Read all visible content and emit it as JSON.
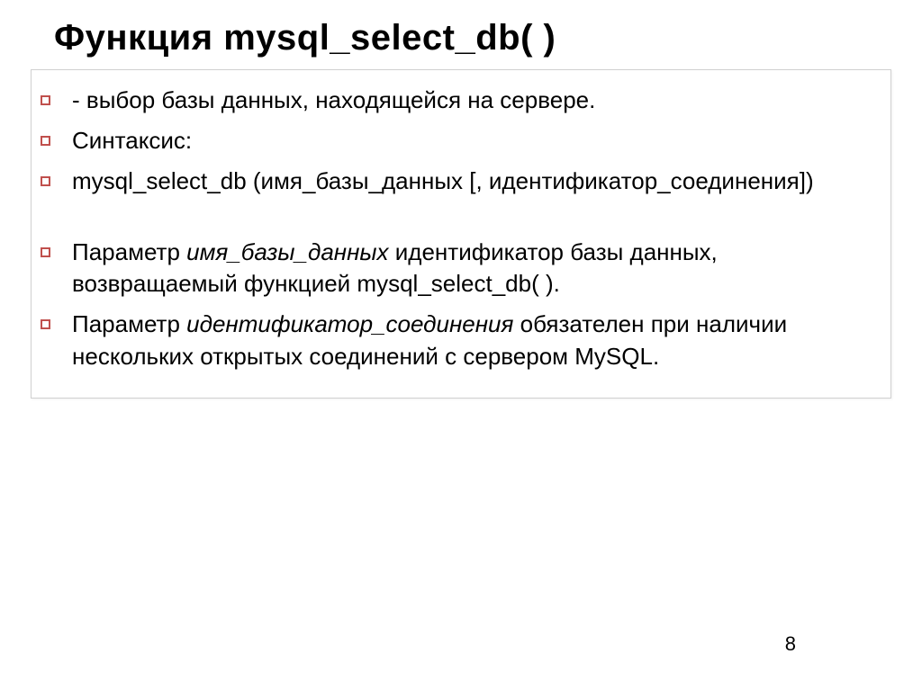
{
  "title": "Функция mysql_select_db( )",
  "bullets": {
    "b1": "- выбор базы данных, находящейся на сервере.",
    "b2": "Синтаксис:",
    "b3": "mysql_select_db (имя_базы_данных [, идентификатор_соединения])",
    "b4_pre": "Параметр ",
    "b4_em": "имя_базы_данных",
    "b4_post": " идентификатор  базы данных, возвращаемый функцией mysql_select_db( ).",
    "b5_pre": "Параметр ",
    "b5_em": "идентификатор_соединения",
    "b5_post": " обязателен при наличии нескольких открытых соединений с сервером MySQL."
  },
  "page_number": "8"
}
